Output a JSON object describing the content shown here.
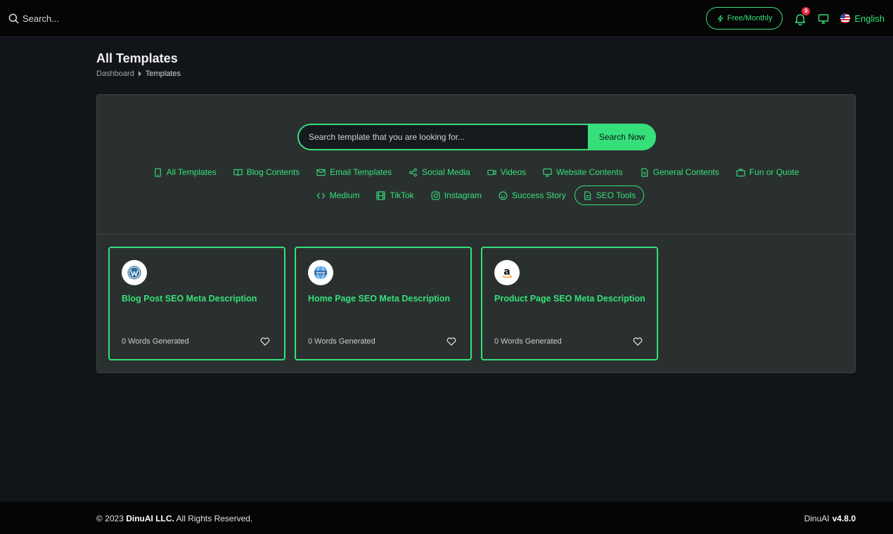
{
  "topbar": {
    "search_label": "Search...",
    "plan_label": "Free/Monthly",
    "notification_count": "0",
    "language": "English"
  },
  "page": {
    "title": "All Templates",
    "breadcrumb": [
      "Dashboard",
      "Templates"
    ]
  },
  "template_search": {
    "placeholder": "Search template that you are looking for...",
    "button": "Search Now"
  },
  "categories": [
    {
      "label": "All Templates",
      "icon": "tablet-icon"
    },
    {
      "label": "Blog Contents",
      "icon": "book-open-icon"
    },
    {
      "label": "Email Templates",
      "icon": "mail-icon"
    },
    {
      "label": "Social Media",
      "icon": "share-icon"
    },
    {
      "label": "Videos",
      "icon": "video-icon"
    },
    {
      "label": "Website Contents",
      "icon": "monitor-icon"
    },
    {
      "label": "General Contents",
      "icon": "document-icon"
    },
    {
      "label": "Fun or Quote",
      "icon": "tv-icon"
    },
    {
      "label": "Medium",
      "icon": "code-icon"
    },
    {
      "label": "TikTok",
      "icon": "film-icon"
    },
    {
      "label": "Instagram",
      "icon": "instagram-icon"
    },
    {
      "label": "Success Story",
      "icon": "smile-icon"
    },
    {
      "label": "SEO Tools",
      "icon": "document-icon",
      "active": true
    }
  ],
  "cards": [
    {
      "title": "Blog Post SEO Meta Description",
      "words": "0 Words Generated",
      "icon": "wordpress-icon"
    },
    {
      "title": "Home Page SEO Meta Description",
      "words": "0 Words Generated",
      "icon": "www-globe-icon"
    },
    {
      "title": "Product Page SEO Meta Description",
      "words": "0 Words Generated",
      "icon": "amazon-icon"
    }
  ],
  "footer": {
    "copyright_prefix": "© 2023 ",
    "company": "DinuAI LLC.",
    "copyright_suffix": " All Rights Reserved.",
    "product": "DinuAI",
    "version": "v4.8.0"
  },
  "colors": {
    "accent": "#35e07a",
    "background": "#111419",
    "panel": "#2a302f",
    "badge": "#e5293c"
  }
}
